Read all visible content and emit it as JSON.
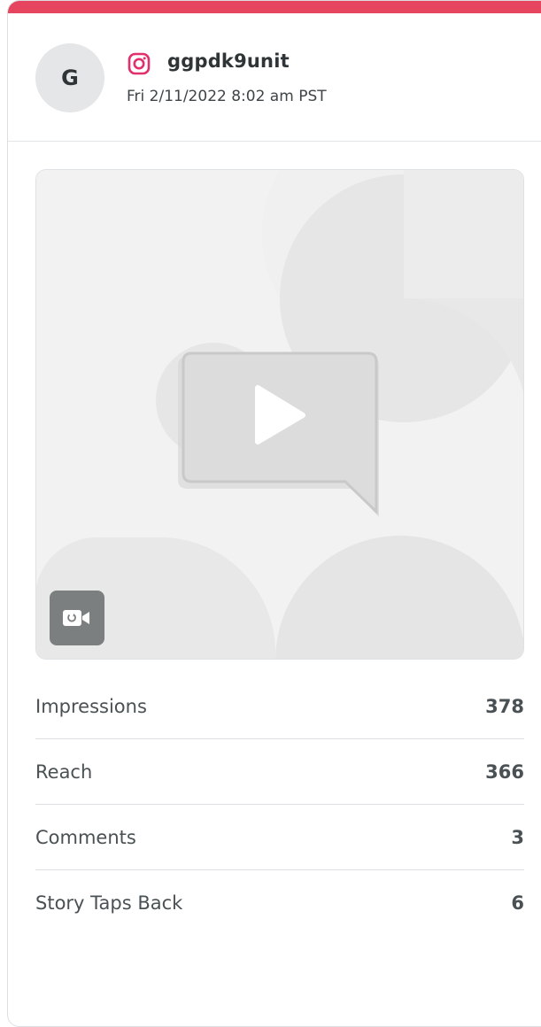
{
  "post": {
    "account_initial": "G",
    "platform_icon": "instagram-icon",
    "username": "ggpdk9unit",
    "timestamp": "Fri 2/11/2022 8:02 am PST"
  },
  "media": {
    "play_icon": "play-icon",
    "badge_icon": "story-video-icon"
  },
  "metrics": [
    {
      "label": "Impressions",
      "value": "378"
    },
    {
      "label": "Reach",
      "value": "366"
    },
    {
      "label": "Comments",
      "value": "3"
    },
    {
      "label": "Story Taps Back",
      "value": "6"
    }
  ],
  "colors": {
    "accent_bar": "#e5455f",
    "instagram": "#e1306c"
  }
}
